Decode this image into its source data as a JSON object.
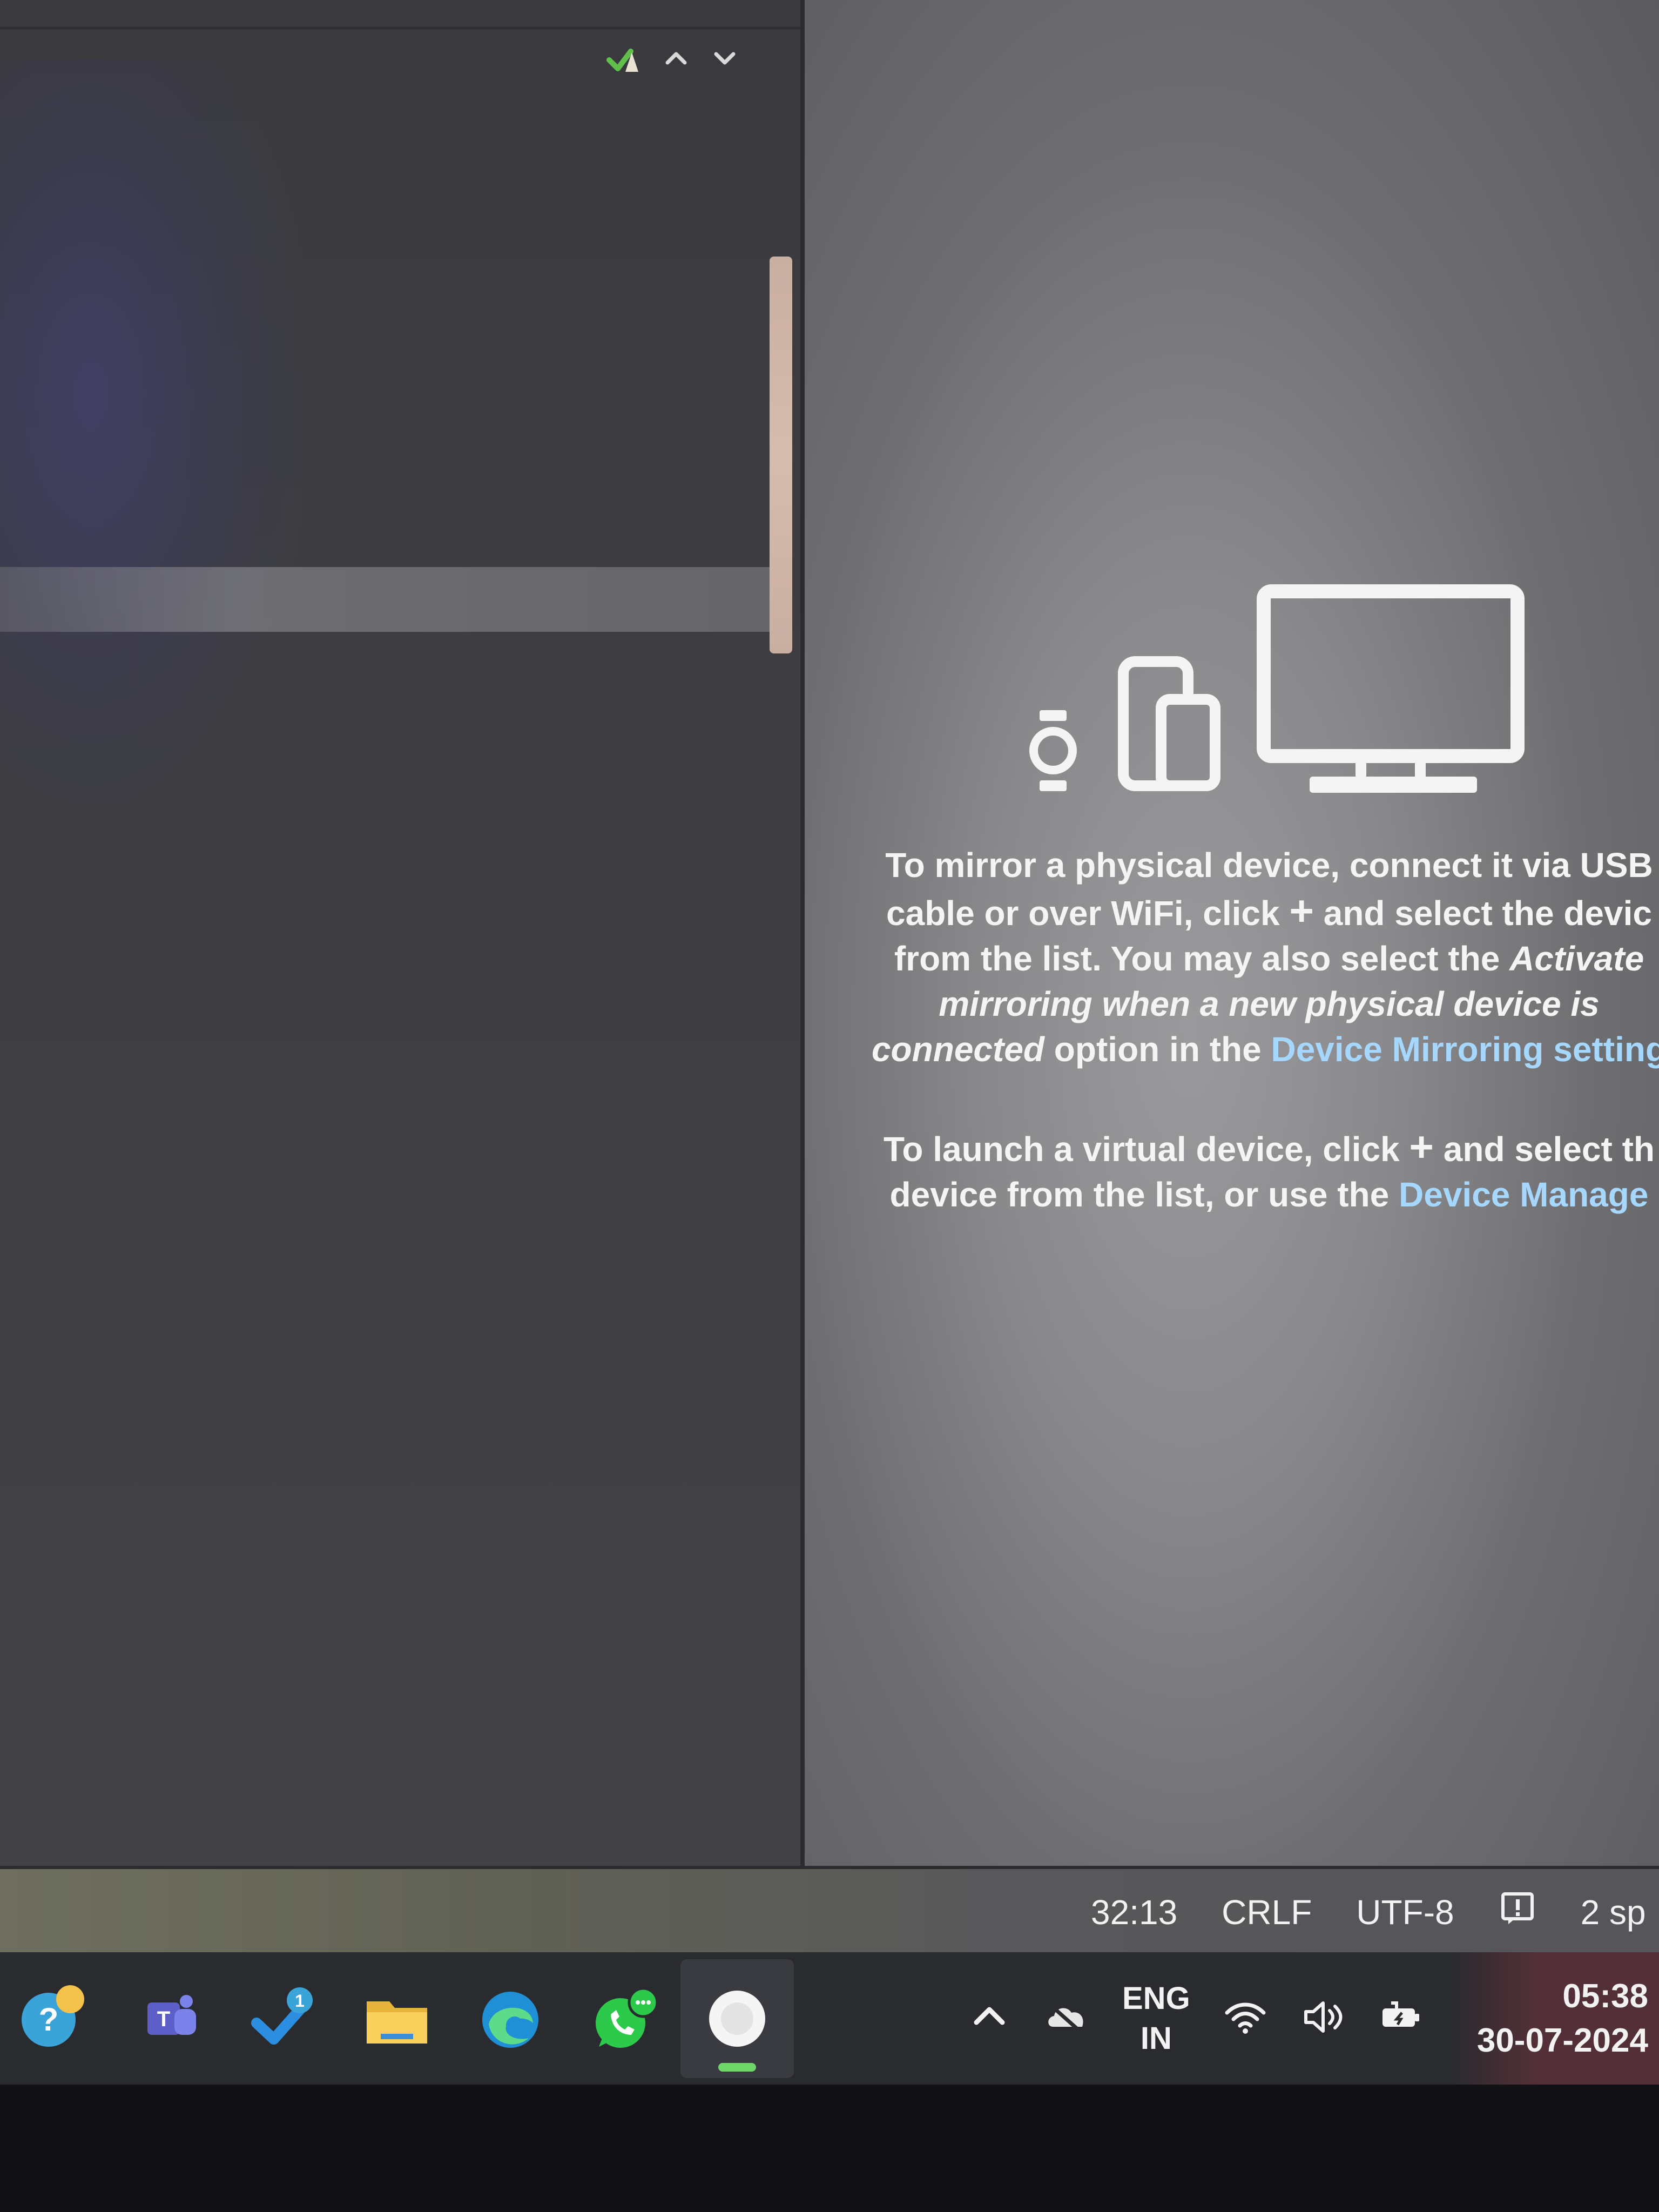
{
  "editor": {
    "inspection_icon": "check-warning-icon",
    "nav_up_icon": "chevron-up-icon",
    "nav_down_icon": "chevron-down-icon"
  },
  "devices_panel": {
    "illustration_icons": [
      "watch-icon",
      "phone-tablet-icon",
      "monitor-icon"
    ],
    "para1": {
      "line1_a": "To mirror a physical device, connect it via USB",
      "line2_a": "cable or over WiFi, click ",
      "line2_plus": "+",
      "line2_b": " and select the devic",
      "line3_a": "from the list. You may also select the ",
      "line3_em": "Activate",
      "line4_em": "mirroring when a new physical device is",
      "line5_em": "connected",
      "line5_b": " option in the ",
      "line5_link": "Device Mirroring setting"
    },
    "para2": {
      "line1_a": "To launch a virtual device, click ",
      "line1_plus": "+",
      "line1_b": " and select th",
      "line2_a": "device from the list, or use the ",
      "line2_link": "Device Manage"
    }
  },
  "status_bar": {
    "position": "32:13",
    "line_separator": "CRLF",
    "encoding": "UTF-8",
    "inspection_icon": "inspection-alert-icon",
    "indent": "2 sp"
  },
  "taskbar": {
    "apps": [
      {
        "name": "get-help-app",
        "icon": "help-icon",
        "active": false
      },
      {
        "name": "teams-app",
        "icon": "teams-icon",
        "active": false
      },
      {
        "name": "todo-app",
        "icon": "todo-check-icon",
        "active": false
      },
      {
        "name": "file-explorer-app",
        "icon": "folder-icon",
        "active": false
      },
      {
        "name": "edge-app",
        "icon": "edge-icon",
        "active": false
      },
      {
        "name": "whatsapp-app",
        "icon": "whatsapp-icon",
        "active": false
      },
      {
        "name": "active-app",
        "icon": "app-icon",
        "active": true
      }
    ],
    "badge_count": "1",
    "tray": {
      "lang_line1": "ENG",
      "lang_line2": "IN"
    },
    "clock": {
      "time": "05:38",
      "date": "30-07-2024"
    }
  },
  "colors": {
    "accent_link": "#a6d7ff",
    "status_green": "#6fd66a",
    "scroll_thumb": "#d6bcae"
  }
}
